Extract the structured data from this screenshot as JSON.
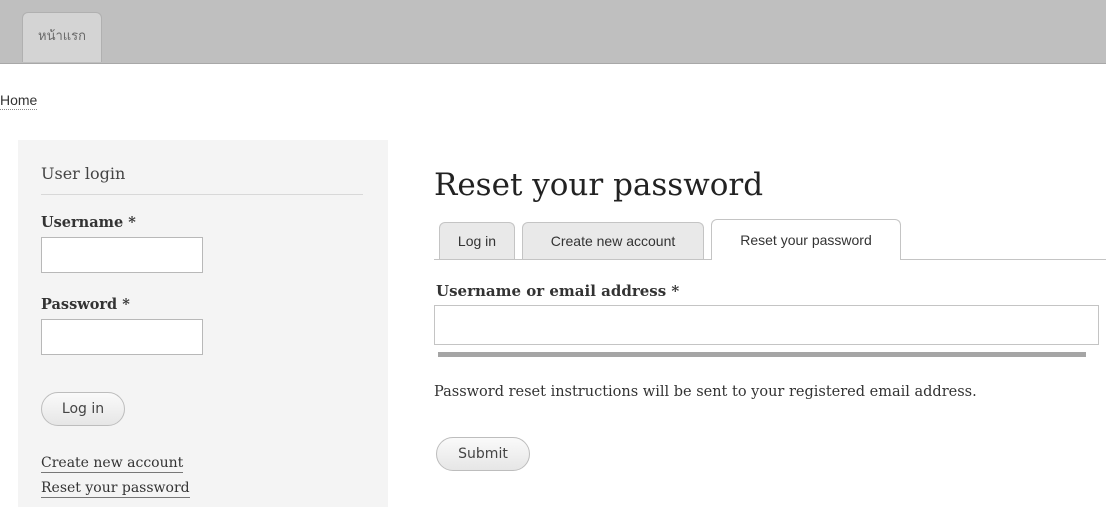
{
  "nav": {
    "home_tab": "หน้าแรก"
  },
  "breadcrumb": {
    "home": "Home"
  },
  "sidebar": {
    "title": "User login",
    "username_label": "Username *",
    "username_value": "",
    "password_label": "Password *",
    "password_value": "",
    "login_button": "Log in",
    "create_account_link": "Create new account",
    "reset_password_link": "Reset your password"
  },
  "main": {
    "title": "Reset your password",
    "tabs": [
      {
        "label": "Log in",
        "active": false
      },
      {
        "label": "Create new account",
        "active": false
      },
      {
        "label": "Reset your password",
        "active": true
      }
    ],
    "field_label": "Username or email address *",
    "field_value": "",
    "help_text": "Password reset instructions will be sent to your registered email address.",
    "submit_button": "Submit"
  }
}
